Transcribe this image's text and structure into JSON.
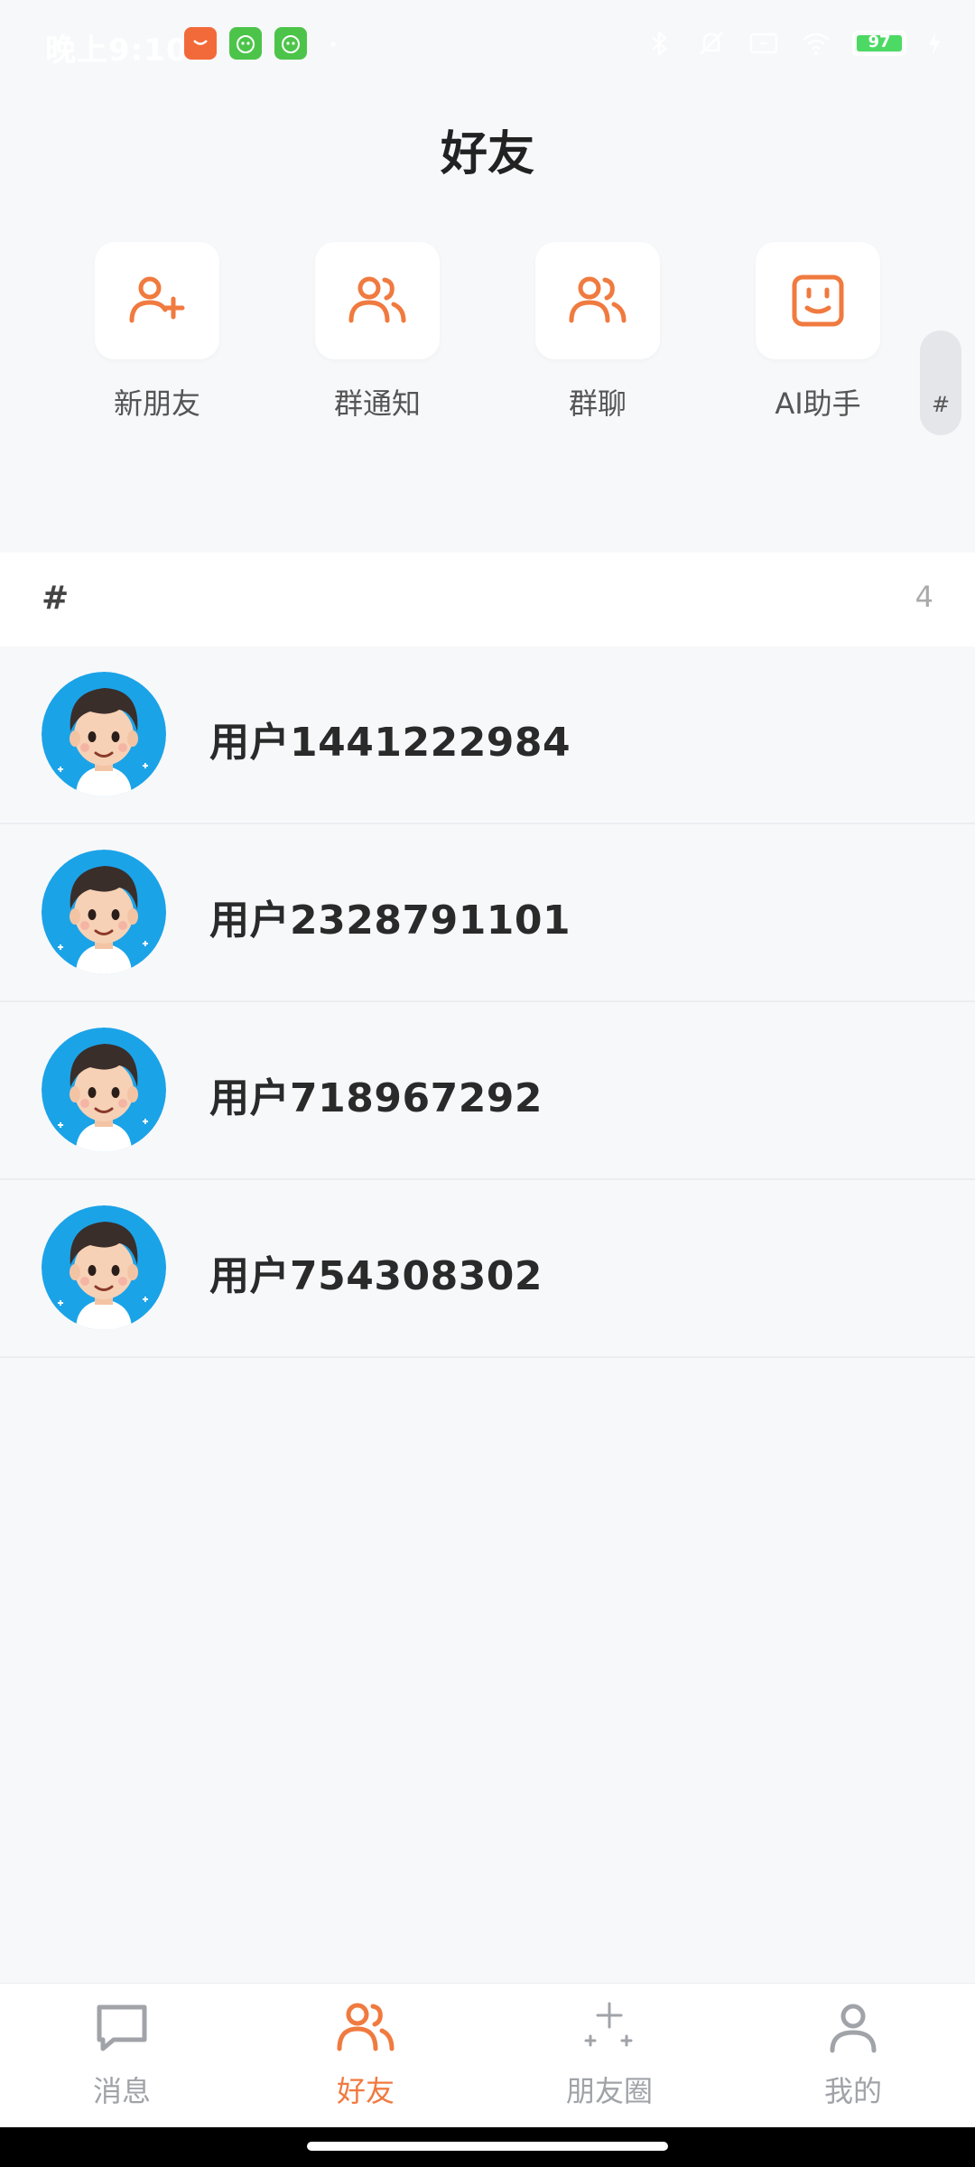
{
  "status_bar": {
    "time": "晚上9:10",
    "battery_level": "97",
    "app_icons": [
      "mall-app-icon",
      "robot-app-icon",
      "robot-app-icon"
    ],
    "right_icons": [
      "bluetooth-icon",
      "mute-icon",
      "screen-icon",
      "wifi-icon",
      "battery-icon",
      "charging-icon"
    ]
  },
  "page": {
    "title": "好友"
  },
  "quick_actions": [
    {
      "label": "新朋友",
      "icon": "add-user-icon"
    },
    {
      "label": "群通知",
      "icon": "group-icon"
    },
    {
      "label": "群聊",
      "icon": "group-icon"
    },
    {
      "label": "AI助手",
      "icon": "robot-face-icon"
    }
  ],
  "index_bar": {
    "letter": "#"
  },
  "section": {
    "letter": "#",
    "count": "4"
  },
  "friends": [
    {
      "name": "用户1441222984"
    },
    {
      "name": "用户2328791101"
    },
    {
      "name": "用户718967292"
    },
    {
      "name": "用户754308302"
    }
  ],
  "tabs": [
    {
      "label": "消息",
      "icon": "chat-bubble-icon",
      "active": false
    },
    {
      "label": "好友",
      "icon": "friends-icon",
      "active": true
    },
    {
      "label": "朋友圈",
      "icon": "sparkle-icon",
      "active": false
    },
    {
      "label": "我的",
      "icon": "profile-icon",
      "active": false
    }
  ],
  "colors": {
    "accent": "#F07A3F",
    "background": "#F7F8FA",
    "inactive_tab": "#A0A3A8",
    "avatar_ring": "#1BA3E8"
  }
}
